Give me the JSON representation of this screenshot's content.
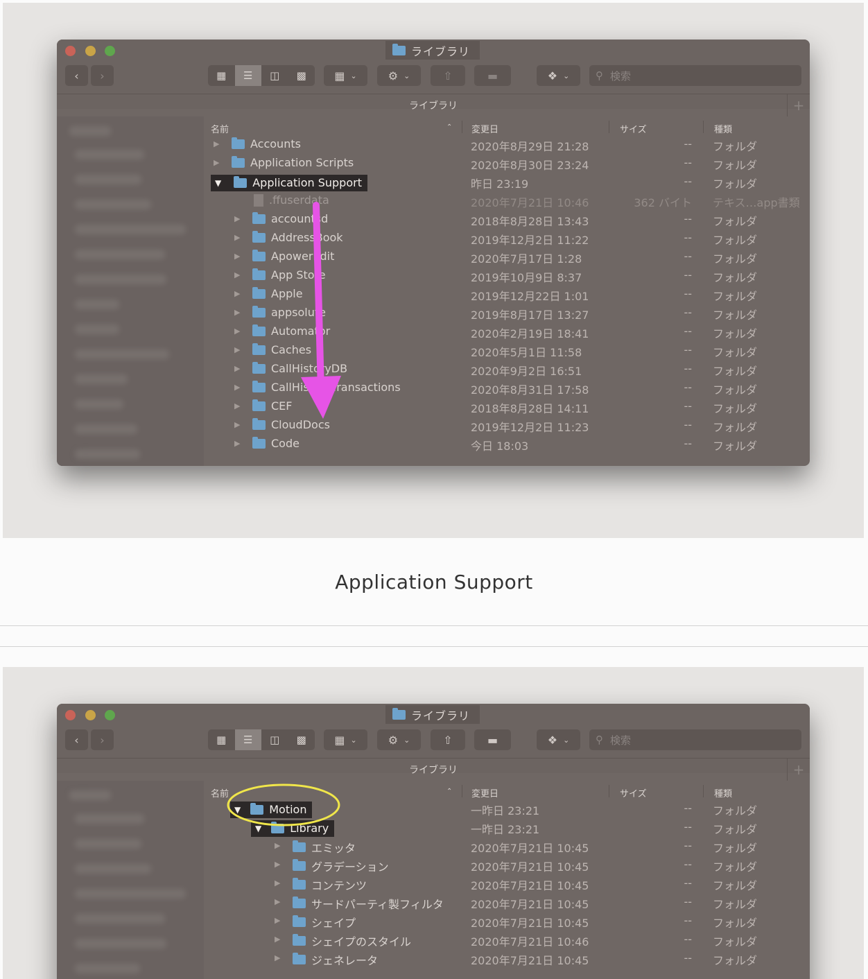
{
  "screenshot1": {
    "window_title": "ライブラリ",
    "tab_title": "ライブラリ",
    "search_placeholder": "検索",
    "columns": {
      "name": "名前",
      "modified": "変更日",
      "size": "サイズ",
      "kind": "種類"
    },
    "rows": [
      {
        "name": "Accounts",
        "date": "2020年8月29日 21:28",
        "size": "--",
        "kind": "フォルダ"
      },
      {
        "name": "Application Scripts",
        "date": "2020年8月30日 23:24",
        "size": "--",
        "kind": "フォルダ"
      },
      {
        "name": "Application Support",
        "date": "昨日 23:19",
        "size": "--",
        "kind": "フォルダ"
      },
      {
        "name": ".ffuserdata",
        "date": "2020年7月21日 10:46",
        "size": "362 バイト",
        "kind": "テキス…app書類"
      },
      {
        "name": "accountsd",
        "date": "2018年8月28日 13:43",
        "size": "--",
        "kind": "フォルダ"
      },
      {
        "name": "AddressBook",
        "date": "2019年12月2日 11:22",
        "size": "--",
        "kind": "フォルダ"
      },
      {
        "name": "ApowerEdit",
        "date": "2020年7月17日 1:28",
        "size": "--",
        "kind": "フォルダ"
      },
      {
        "name": "App Store",
        "date": "2019年10月9日 8:37",
        "size": "--",
        "kind": "フォルダ"
      },
      {
        "name": "Apple",
        "date": "2019年12月22日 1:01",
        "size": "--",
        "kind": "フォルダ"
      },
      {
        "name": "appsolute",
        "date": "2019年8月17日 13:27",
        "size": "--",
        "kind": "フォルダ"
      },
      {
        "name": "Automator",
        "date": "2020年2月19日 18:41",
        "size": "--",
        "kind": "フォルダ"
      },
      {
        "name": "Caches",
        "date": "2020年5月1日 11:58",
        "size": "--",
        "kind": "フォルダ"
      },
      {
        "name": "CallHistoryDB",
        "date": "2020年9月2日 16:51",
        "size": "--",
        "kind": "フォルダ"
      },
      {
        "name": "CallHistoryTransactions",
        "date": "2020年8月31日 17:58",
        "size": "--",
        "kind": "フォルダ"
      },
      {
        "name": "CEF",
        "date": "2018年8月28日 14:11",
        "size": "--",
        "kind": "フォルダ"
      },
      {
        "name": "CloudDocs",
        "date": "2019年12月2日 11:23",
        "size": "--",
        "kind": "フォルダ"
      },
      {
        "name": "Code",
        "date": "今日 18:03",
        "size": "--",
        "kind": "フォルダ"
      }
    ]
  },
  "caption": "Application Support",
  "screenshot2": {
    "window_title": "ライブラリ",
    "tab_title": "ライブラリ",
    "search_placeholder": "検索",
    "columns": {
      "name": "名前",
      "modified": "変更日",
      "size": "サイズ",
      "kind": "種類"
    },
    "rows": [
      {
        "name": "Motion",
        "date": "一昨日 23:21",
        "size": "--",
        "kind": "フォルダ"
      },
      {
        "name": "Library",
        "date": "一昨日 23:21",
        "size": "--",
        "kind": "フォルダ"
      },
      {
        "name": "エミッタ",
        "date": "2020年7月21日 10:45",
        "size": "--",
        "kind": "フォルダ"
      },
      {
        "name": "グラデーション",
        "date": "2020年7月21日 10:45",
        "size": "--",
        "kind": "フォルダ"
      },
      {
        "name": "コンテンツ",
        "date": "2020年7月21日 10:45",
        "size": "--",
        "kind": "フォルダ"
      },
      {
        "name": "サードパーティ製フィルタ",
        "date": "2020年7月21日 10:45",
        "size": "--",
        "kind": "フォルダ"
      },
      {
        "name": "シェイプ",
        "date": "2020年7月21日 10:45",
        "size": "--",
        "kind": "フォルダ"
      },
      {
        "name": "シェイプのスタイル",
        "date": "2020年7月21日 10:46",
        "size": "--",
        "kind": "フォルダ"
      },
      {
        "name": "ジェネレータ",
        "date": "2020年7月21日 10:45",
        "size": "--",
        "kind": "フォルダ"
      }
    ]
  },
  "colors": {
    "arrow": "#e654e6",
    "highlight_ellipse": "#f0e64a",
    "selection": "#2c2828"
  },
  "icons": [
    "close-icon",
    "minimize-icon",
    "zoom-icon",
    "back-icon",
    "forward-icon",
    "icon-view-icon",
    "list-view-icon",
    "column-view-icon",
    "gallery-view-icon",
    "group-icon",
    "gear-icon",
    "share-icon",
    "tag-icon",
    "dropbox-icon",
    "search-icon",
    "folder-icon",
    "file-icon",
    "disclosure-icon"
  ]
}
